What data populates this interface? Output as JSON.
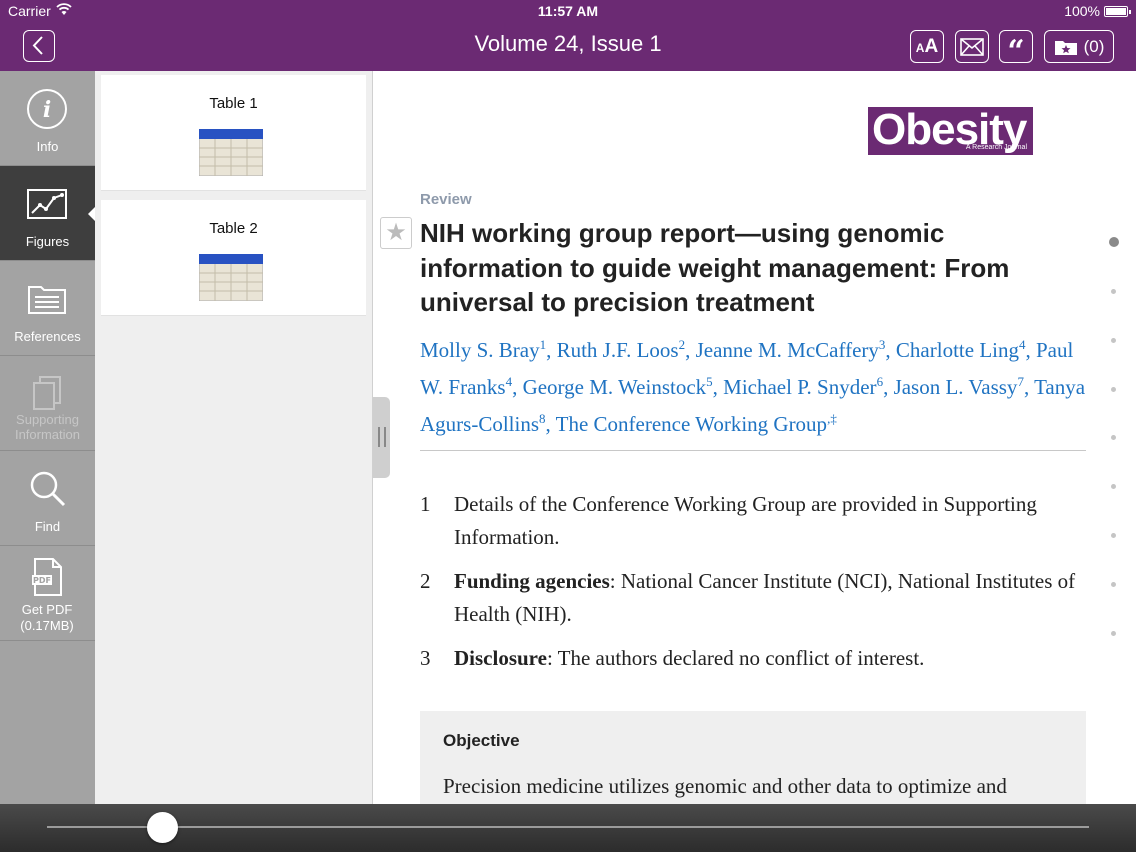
{
  "status_bar": {
    "carrier": "Carrier",
    "time": "11:57 AM",
    "battery": "100%"
  },
  "header": {
    "title": "Volume 24, Issue 1",
    "font_button": "AA",
    "quote_button": "“",
    "saved_count": "(0)"
  },
  "sidebar": {
    "items": [
      {
        "label": "Info",
        "icon": "info-icon",
        "state": "normal"
      },
      {
        "label": "Figures",
        "icon": "chart-icon",
        "state": "active"
      },
      {
        "label": "References",
        "icon": "folder-icon",
        "state": "normal"
      },
      {
        "label": "Supporting Information",
        "icon": "documents-icon",
        "state": "disabled"
      },
      {
        "label": "Find",
        "icon": "search-icon",
        "state": "normal"
      },
      {
        "label": "Get PDF (0.17MB)",
        "icon": "pdf-icon",
        "state": "normal"
      }
    ]
  },
  "figures": [
    {
      "label": "Table 1"
    },
    {
      "label": "Table 2"
    }
  ],
  "article": {
    "journal_logo": {
      "name": "Obesity",
      "tagline": "A Research Journal"
    },
    "section_type": "Review",
    "title": "NIH working group report—using genomic information to guide weight management: From universal to precision treatment",
    "authors": [
      {
        "name": "Molly S. Bray",
        "sup": "1"
      },
      {
        "name": "Ruth J.F. Loos",
        "sup": "2"
      },
      {
        "name": "Jeanne M. McCaffery",
        "sup": "3"
      },
      {
        "name": "Charlotte Ling",
        "sup": "4"
      },
      {
        "name": "Paul W. Franks",
        "sup": "4"
      },
      {
        "name": "George M. Weinstock",
        "sup": "5"
      },
      {
        "name": "Michael P. Snyder",
        "sup": "6"
      },
      {
        "name": "Jason L. Vassy",
        "sup": "7"
      },
      {
        "name": "Tanya Agurs-Collins",
        "sup": "8"
      },
      {
        "name": "The Conference Working Group",
        "sup": ",‡"
      }
    ],
    "notes": [
      {
        "num": "1",
        "bold": "",
        "text": "Details of the Conference Working Group are provided in Supporting Information."
      },
      {
        "num": "2",
        "bold": "Funding agencies",
        "text": ": National Cancer Institute (NCI), National Institutes of Health (NIH)."
      },
      {
        "num": "3",
        "bold": "Disclosure",
        "text": ": The authors declared no conflict of interest."
      }
    ],
    "abstract": {
      "heading": "Objective",
      "text": "Precision medicine utilizes genomic and other data to optimize and"
    }
  },
  "page_indicator": {
    "count": 9,
    "current": 1
  },
  "reading_progress": 0.11,
  "colors": {
    "brand": "#6b2a73",
    "link": "#1f73c2",
    "sidebar": "#a3a3a3",
    "sidebar_active": "#3e3e3e"
  }
}
